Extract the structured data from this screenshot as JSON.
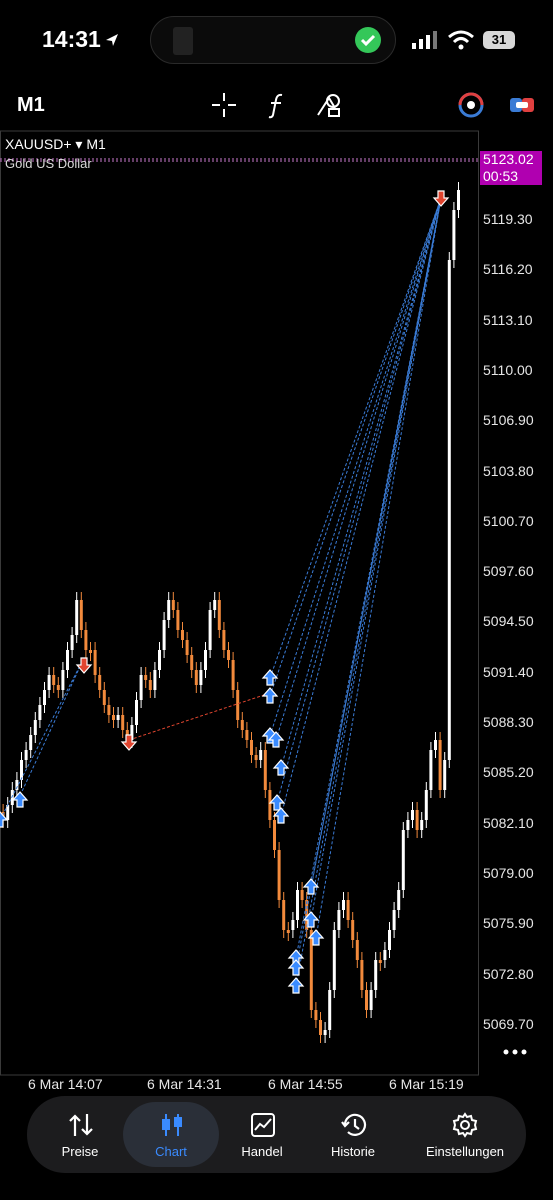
{
  "status": {
    "time": "14:31",
    "battery": "31"
  },
  "toolbar": {
    "timeframe": "M1"
  },
  "chart": {
    "symbol": "XAUUSD+ ▾ M1",
    "description": "Gold US Dollar",
    "current_price": "5123.02",
    "countdown": "00:53",
    "price_labels": [
      "5119.30",
      "5116.20",
      "5113.10",
      "5110.00",
      "5106.90",
      "5103.80",
      "5100.70",
      "5097.60",
      "5094.50",
      "5091.40",
      "5088.30",
      "5085.20",
      "5082.10",
      "5079.00",
      "5075.90",
      "5072.80",
      "5069.70"
    ],
    "time_labels": [
      "6 Mar 14:07",
      "6 Mar 14:31",
      "6 Mar 14:55",
      "6 Mar 15:19"
    ],
    "colors": {
      "bull": "#ffffff",
      "bear": "#f28a3c",
      "buy_arrow": "#3a8bff",
      "sell_arrow": "#e0452f",
      "price_tag": "#b000b0"
    }
  },
  "tabs": [
    {
      "label": "Preise",
      "icon": "arrows-updown-icon"
    },
    {
      "label": "Chart",
      "icon": "candles-icon"
    },
    {
      "label": "Handel",
      "icon": "trade-chart-icon"
    },
    {
      "label": "Historie",
      "icon": "history-icon"
    },
    {
      "label": "Einstellungen",
      "icon": "gear-icon"
    }
  ]
}
